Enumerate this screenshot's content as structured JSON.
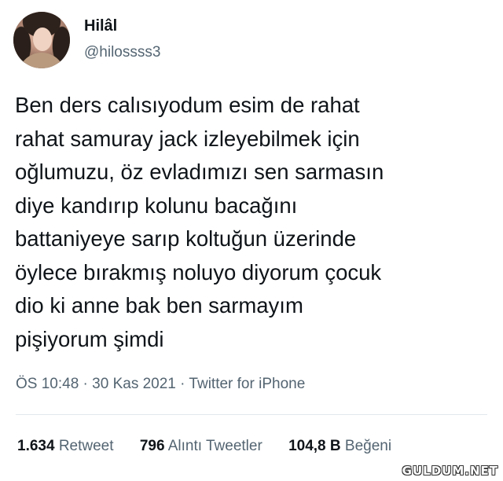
{
  "author": {
    "display_name": "Hilâl",
    "handle": "@hilossss3"
  },
  "tweet": {
    "text": "Ben ders calısıyodum esim de rahat\nrahat samuray jack izleyebilmek için\noğlumuzu, öz evladımızı sen sarmasın\ndiye kandırıp kolunu bacağını\nbattaniyeye sarıp koltuğun üzerinde\nöylece bırakmış noluyo diyorum çocuk\ndio ki anne bak ben sarmayım\npişiyorum şimdi"
  },
  "meta": {
    "time": "ÖS 10:48",
    "separator1": " · ",
    "date": "30 Kas 2021",
    "separator2": " · ",
    "source": "Twitter for iPhone"
  },
  "stats": {
    "retweets_count": "1.634",
    "retweets_label": "Retweet",
    "quotes_count": "796",
    "quotes_label": "Alıntı Tweetler",
    "likes_count": "104,8 B",
    "likes_label": "Beğeni"
  },
  "watermark": "GULDUM.NET"
}
